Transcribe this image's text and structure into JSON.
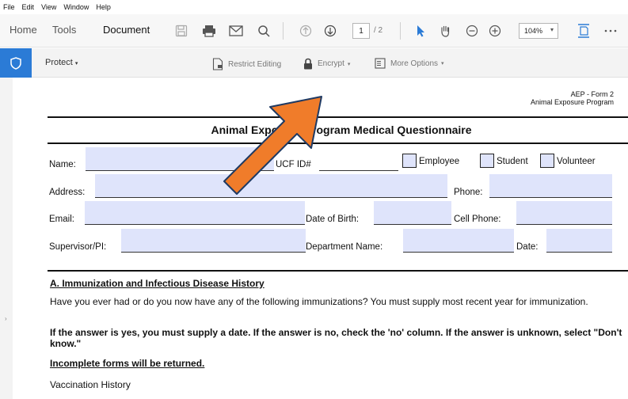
{
  "menu": {
    "items": [
      "File",
      "Edit",
      "View",
      "Window",
      "Help"
    ]
  },
  "nav": {
    "home": "Home",
    "tools": "Tools",
    "document": "Document"
  },
  "paging": {
    "current": "1",
    "total": "/ 2"
  },
  "zoom": {
    "value": "104%"
  },
  "protect": {
    "label": "Protect",
    "restrict": "Restrict Editing",
    "encrypt": "Encrypt",
    "more": "More Options"
  },
  "form": {
    "id_line1": "AEP - Form 2",
    "id_line2": "Animal Exposure Program",
    "title": "Animal Exposure Program Medical Questionnaire",
    "name": "Name:",
    "ucf_id": "UCF ID#",
    "employee": "Employee",
    "student": "Student",
    "volunteer": "Volunteer",
    "address": "Address:",
    "phone": "Phone:",
    "email": "Email:",
    "dob": "Date of Birth:",
    "cell": "Cell Phone:",
    "supervisor": "Supervisor/PI:",
    "department": "Department Name:",
    "date": "Date:"
  },
  "section_a": {
    "heading": "A. Immunization and Infectious Disease History",
    "para1": "Have you ever had or do you now have any of the following immunizations? You must supply most recent year for immunization.",
    "para2": "If the answer is yes, you must supply a date. If the answer is no, check the 'no' column. If the answer is unknown, select \"Don't know.\"",
    "para3": "Incomplete forms will be returned.",
    "para4": "Vaccination History"
  },
  "colors": {
    "accent": "#2b7bd6",
    "field_fill": "#dfe4fb",
    "arrow": "#f07c2a"
  }
}
